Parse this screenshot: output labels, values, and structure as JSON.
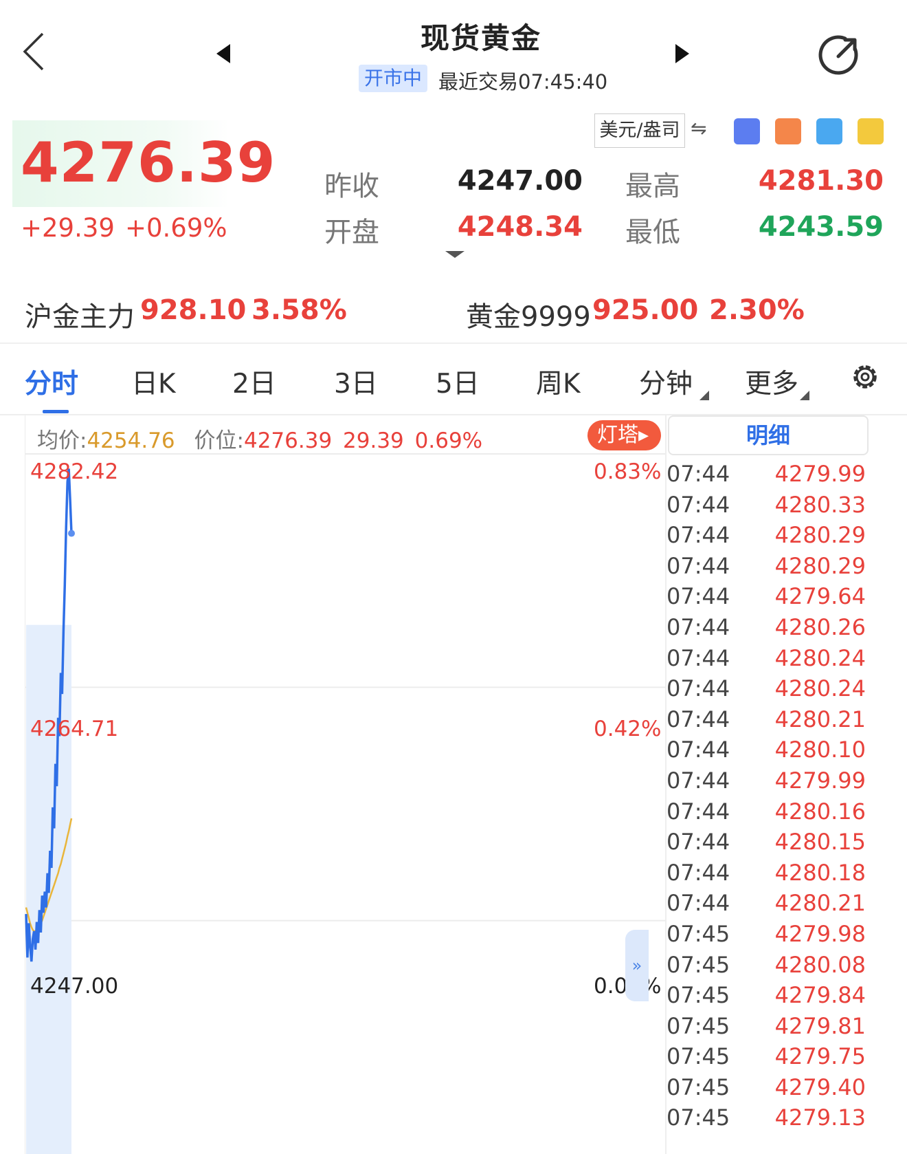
{
  "header": {
    "title": "现货黄金",
    "status": "开市中",
    "last_trade": "最近交易07:45:40"
  },
  "quote": {
    "price": "4276.39",
    "change": "+29.39",
    "change_pct": "+0.69%",
    "unit": "美元/盎司",
    "swap_symbol": "⇋",
    "prev_close_label": "昨收",
    "prev_close": "4247.00",
    "open_label": "开盘",
    "open": "4248.34",
    "high_label": "最高",
    "high": "4281.30",
    "low_label": "最低",
    "low": "4243.59"
  },
  "related": [
    {
      "name": "沪金主力",
      "price": "928.10",
      "pct": "3.58%"
    },
    {
      "name": "黄金9999",
      "price": "925.00",
      "pct": "2.30%"
    }
  ],
  "tabs": [
    "分时",
    "日K",
    "2日",
    "3日",
    "5日",
    "周K",
    "分钟",
    "更多"
  ],
  "chart_info": {
    "avg_label": "均价:",
    "avg_value": "4254.76",
    "pos_label": "价位:",
    "pos_value": "4276.39",
    "pos_change": "29.39",
    "pos_pct": "0.69%",
    "lighthouse": "灯塔▸",
    "collapse": "»"
  },
  "chart_data": {
    "type": "line",
    "title": "",
    "y_labels_left": [
      "4282.42",
      "4264.71",
      "4247.00"
    ],
    "y_labels_right": [
      "0.83%",
      "0.42%",
      "0.00%"
    ],
    "ylim": [
      4229.29,
      4282.42
    ],
    "base": 4247.0,
    "series": [
      {
        "name": "价位",
        "color": "#2f6fe6",
        "values": [
          4247.5,
          4244.2,
          4246.8,
          4245.1,
          4243.9,
          4245.6,
          4246.2,
          4244.8,
          4246.9,
          4245.3,
          4247.8,
          4246.1,
          4248.9,
          4247.6,
          4249.2,
          4248.0,
          4250.6,
          4249.1,
          4252.3,
          4251.0,
          4255.6,
          4254.0,
          4258.9,
          4257.2,
          4262.4,
          4261.0,
          4265.8,
          4264.2,
          4269.0,
          4272.5,
          4276.8,
          4280.3,
          4281.3,
          4278.9,
          4276.39
        ]
      },
      {
        "name": "均价",
        "color": "#e9b53a",
        "values": [
          4248.0,
          4247.6,
          4247.2,
          4246.8,
          4246.5,
          4246.3,
          4246.2,
          4246.2,
          4246.3,
          4246.4,
          4246.6,
          4246.8,
          4247.0,
          4247.3,
          4247.6,
          4247.9,
          4248.2,
          4248.5,
          4248.8,
          4249.1,
          4249.4,
          4249.7,
          4250.0,
          4250.3,
          4250.6,
          4251.0,
          4251.3,
          4251.7,
          4252.1,
          4252.5,
          4252.9,
          4253.4,
          4253.8,
          4254.3,
          4254.76
        ]
      }
    ]
  },
  "detail": {
    "title": "明细",
    "rows": [
      {
        "time": "07:44",
        "price": "4279.99"
      },
      {
        "time": "07:44",
        "price": "4280.33"
      },
      {
        "time": "07:44",
        "price": "4280.29"
      },
      {
        "time": "07:44",
        "price": "4280.29"
      },
      {
        "time": "07:44",
        "price": "4279.64"
      },
      {
        "time": "07:44",
        "price": "4280.26"
      },
      {
        "time": "07:44",
        "price": "4280.24"
      },
      {
        "time": "07:44",
        "price": "4280.24"
      },
      {
        "time": "07:44",
        "price": "4280.21"
      },
      {
        "time": "07:44",
        "price": "4280.10"
      },
      {
        "time": "07:44",
        "price": "4279.99"
      },
      {
        "time": "07:44",
        "price": "4280.16"
      },
      {
        "time": "07:44",
        "price": "4280.15"
      },
      {
        "time": "07:44",
        "price": "4280.18"
      },
      {
        "time": "07:44",
        "price": "4280.21"
      },
      {
        "time": "07:45",
        "price": "4279.98"
      },
      {
        "time": "07:45",
        "price": "4280.08"
      },
      {
        "time": "07:45",
        "price": "4279.84"
      },
      {
        "time": "07:45",
        "price": "4279.81"
      },
      {
        "time": "07:45",
        "price": "4279.75"
      },
      {
        "time": "07:45",
        "price": "4279.40"
      },
      {
        "time": "07:45",
        "price": "4279.13"
      }
    ]
  },
  "icons": {
    "back": "chevron-left-icon",
    "prev": "triangle-left-icon",
    "next": "triangle-right-icon",
    "refresh": "refresh-icon",
    "settings": "gear-icon"
  }
}
